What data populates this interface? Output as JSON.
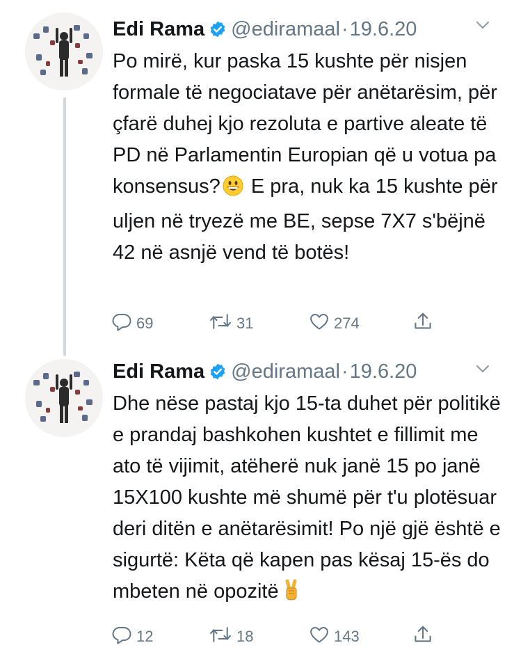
{
  "colors": {
    "text": "#14171a",
    "muted": "#657786",
    "verified": "#1da1f2",
    "thread_line": "#cfd9de"
  },
  "tweets": [
    {
      "author": {
        "name": "Edi Rama",
        "handle": "@ediramaal",
        "verified": true
      },
      "separator": "·",
      "date": "19.6.20",
      "text_before_emoji": "Po mirë, kur paska 15 kushte për nisjen formale të negociatave për anëtarësim, për çfarë duhej kjo rezoluta e partive aleate të PD në Parlamentin Europian që u votua pa konsensus?",
      "emoji": "grinning-face-emoji",
      "text_after_emoji": " E pra, nuk ka 15 kushte për uljen në tryezë me BE, sepse 7X7 s'bëjnë 42 në asnjë vend të botës!",
      "stats": {
        "replies": "69",
        "retweets": "31",
        "likes": "274"
      },
      "icons": {
        "reply": "reply-icon",
        "retweet": "retweet-icon",
        "like": "heart-icon",
        "share": "share-icon",
        "menu": "chevron-down-icon"
      }
    },
    {
      "author": {
        "name": "Edi Rama",
        "handle": "@ediramaal",
        "verified": true
      },
      "separator": "·",
      "date": "19.6.20",
      "text_before_emoji": "Dhe nëse pastaj kjo 15-ta duhet për politikë e prandaj bashkohen kushtet e fillimit me ato të vijimit, atëherë nuk janë 15 po janë 15X100 kushte më shumë për t'u plotësuar deri ditën e anëtarësimit! Po një gjë është e sigurtë: Këta që kapen pas kësaj 15-ës do mbeten në opozitë",
      "emoji": "victory-hand-emoji",
      "text_after_emoji": "",
      "stats": {
        "replies": "12",
        "retweets": "18",
        "likes": "143"
      },
      "icons": {
        "reply": "reply-icon",
        "retweet": "retweet-icon",
        "like": "heart-icon",
        "share": "share-icon",
        "menu": "chevron-down-icon"
      }
    }
  ]
}
